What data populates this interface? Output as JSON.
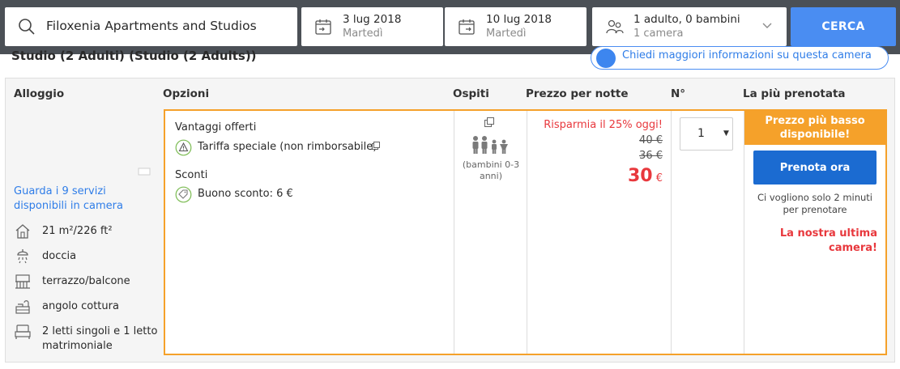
{
  "search": {
    "destination": "Filoxenia Apartments and Studios",
    "checkin": {
      "date": "3 lug 2018",
      "weekday": "Martedì"
    },
    "checkout": {
      "date": "10 lug 2018",
      "weekday": "Martedì"
    },
    "guests": {
      "line1": "1 adulto, 0 bambini",
      "line2": "1 camera"
    },
    "search_button": "CERCA",
    "accent": "#4a8df2"
  },
  "room": {
    "title": "Studio (2 Adulti) (Studio (2 Adults))",
    "more_info_link": "Chiedi maggiori informazioni su questa camera"
  },
  "table": {
    "headers": {
      "room": "Alloggio",
      "options": "Opzioni",
      "guests": "Ospiti",
      "price": "Prezzo per notte",
      "qty": "N°",
      "popular": "La più prenotata"
    }
  },
  "room_info": {
    "facilities_link": "Guarda i 9 servizi disponibili in camera",
    "amenities": [
      {
        "icon": "house-icon",
        "label": "21 m²/226 ft²"
      },
      {
        "icon": "shower-icon",
        "label": "doccia"
      },
      {
        "icon": "balcony-icon",
        "label": "terrazzo/balcone"
      },
      {
        "icon": "kitchenette-icon",
        "label": "angolo cottura"
      },
      {
        "icon": "bed-icon",
        "label": "2 letti singoli e 1 letto matrimoniale"
      }
    ]
  },
  "offer": {
    "benefits_heading": "Vantaggi offerti",
    "rate_label": "Tariffa speciale (non rimborsabile)",
    "discounts_heading": "Sconti",
    "coupon_label": "Buono sconto: 6 €",
    "guests_note": "(bambini 0-3 anni)",
    "save_text": "Risparmia il 25% oggi!",
    "original_price": "40 €",
    "discounted_price": "36 €",
    "final_price": "30",
    "currency": "€",
    "qty_value": "1",
    "badge": "Prezzo più basso disponibile!",
    "book_button": "Prenota ora",
    "book_note": "Ci vogliono solo 2 minuti per prenotare",
    "last_room": "La nostra ultima camera!",
    "colors": {
      "highlight": "#f5a12a",
      "sale": "#e8383d",
      "book": "#1b6bd1"
    }
  }
}
